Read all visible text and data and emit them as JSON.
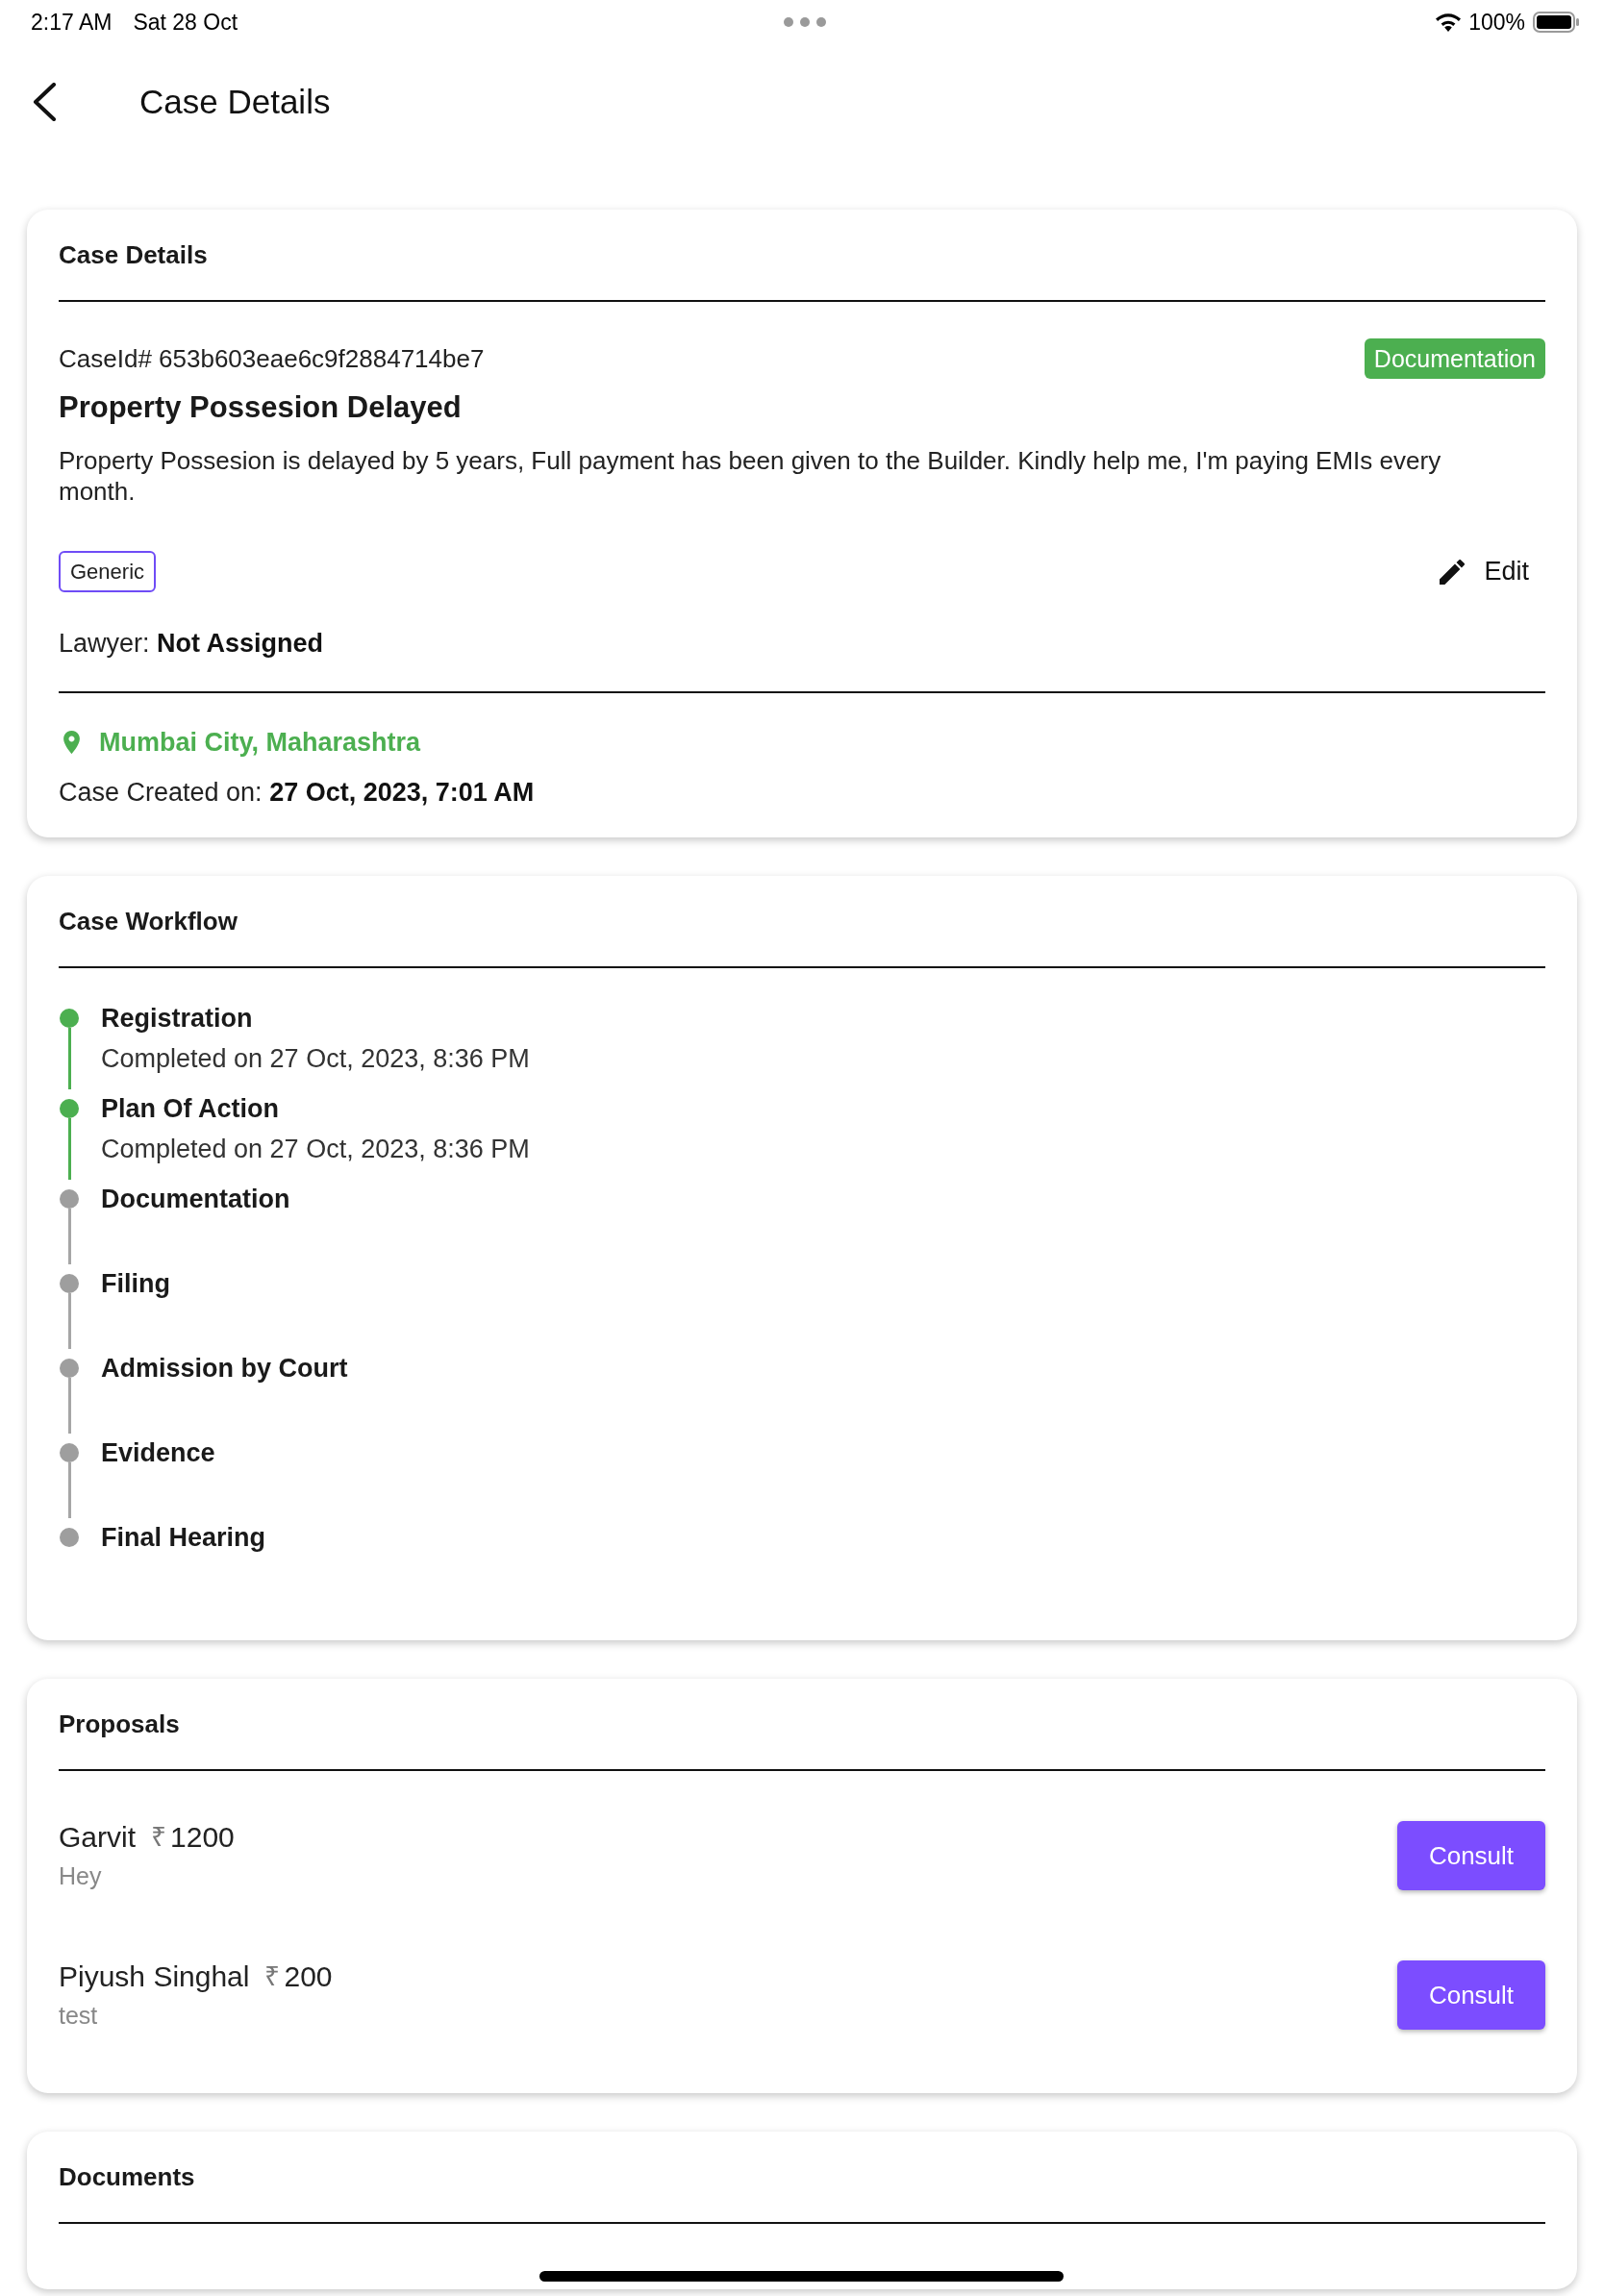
{
  "status_bar": {
    "time": "2:17 AM",
    "date": "Sat 28 Oct",
    "battery": "100%"
  },
  "header": {
    "title": "Case Details"
  },
  "case_details": {
    "title": "Case Details",
    "case_id": "CaseId# 653b603eae6c9f2884714be7",
    "status": "Documentation",
    "case_title": "Property Possesion Delayed",
    "description": "Property Possesion is delayed by 5 years, Full payment has been given to the Builder. Kindly help me, I'm paying EMIs every month.",
    "tag": "Generic",
    "edit_label": "Edit",
    "lawyer": "Lawyer: **Not Assigned**",
    "location": "Mumbai City, Maharashtra",
    "created": "Case Created on: **27 Oct, 2023, 7:01 AM**"
  },
  "workflow": {
    "title": "Case Workflow",
    "steps": [
      {
        "name": "Registration",
        "completed": true,
        "note": "Completed on 27 Oct, 2023, 8:36 PM"
      },
      {
        "name": "Plan Of Action",
        "completed": true,
        "note": "Completed on 27 Oct, 2023, 8:36 PM"
      },
      {
        "name": "Documentation",
        "completed": false
      },
      {
        "name": "Filing",
        "completed": false
      },
      {
        "name": "Admission by Court",
        "completed": false
      },
      {
        "name": "Evidence",
        "completed": false
      },
      {
        "name": "Final Hearing",
        "completed": false
      }
    ]
  },
  "proposals": {
    "title": "Proposals",
    "items": [
      {
        "name": "Garvit",
        "currency": "₹",
        "amount": "1200",
        "message": "Hey",
        "button": "Consult"
      },
      {
        "name": "Piyush Singhal",
        "currency": "₹",
        "amount": "200",
        "message": "test",
        "button": "Consult"
      }
    ]
  },
  "documents": {
    "title": "Documents"
  }
}
